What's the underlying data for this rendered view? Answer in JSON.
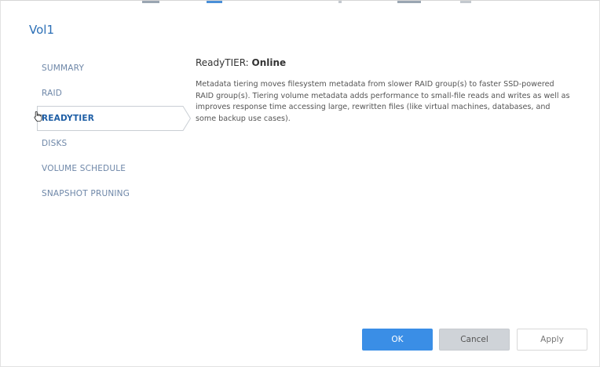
{
  "dialog": {
    "title": "Vol1"
  },
  "nav": {
    "items": [
      {
        "label": "SUMMARY"
      },
      {
        "label": "RAID"
      },
      {
        "label": "READYTIER"
      },
      {
        "label": "DISKS"
      },
      {
        "label": "VOLUME SCHEDULE"
      },
      {
        "label": "SNAPSHOT PRUNING"
      }
    ],
    "active_index": 2
  },
  "content": {
    "heading_prefix": "ReadyTIER: ",
    "heading_status": "Online",
    "description": "Metadata tiering moves filesystem metadata from slower RAID group(s) to faster SSD-powered RAID group(s). Tiering volume metadata adds performance to small-file reads and writes as well as improves response time accessing large, rewritten files (like virtual machines, databases, and some backup use cases)."
  },
  "buttons": {
    "ok": "OK",
    "cancel": "Cancel",
    "apply": "Apply"
  },
  "colors": {
    "title": "#2b6fb6",
    "nav_text": "#6e87a8",
    "nav_active": "#1f5fa6",
    "primary_button": "#3a8ee6",
    "cancel_button": "#cfd3d8"
  },
  "icons": {
    "cursor": "hand-pointer-icon"
  }
}
